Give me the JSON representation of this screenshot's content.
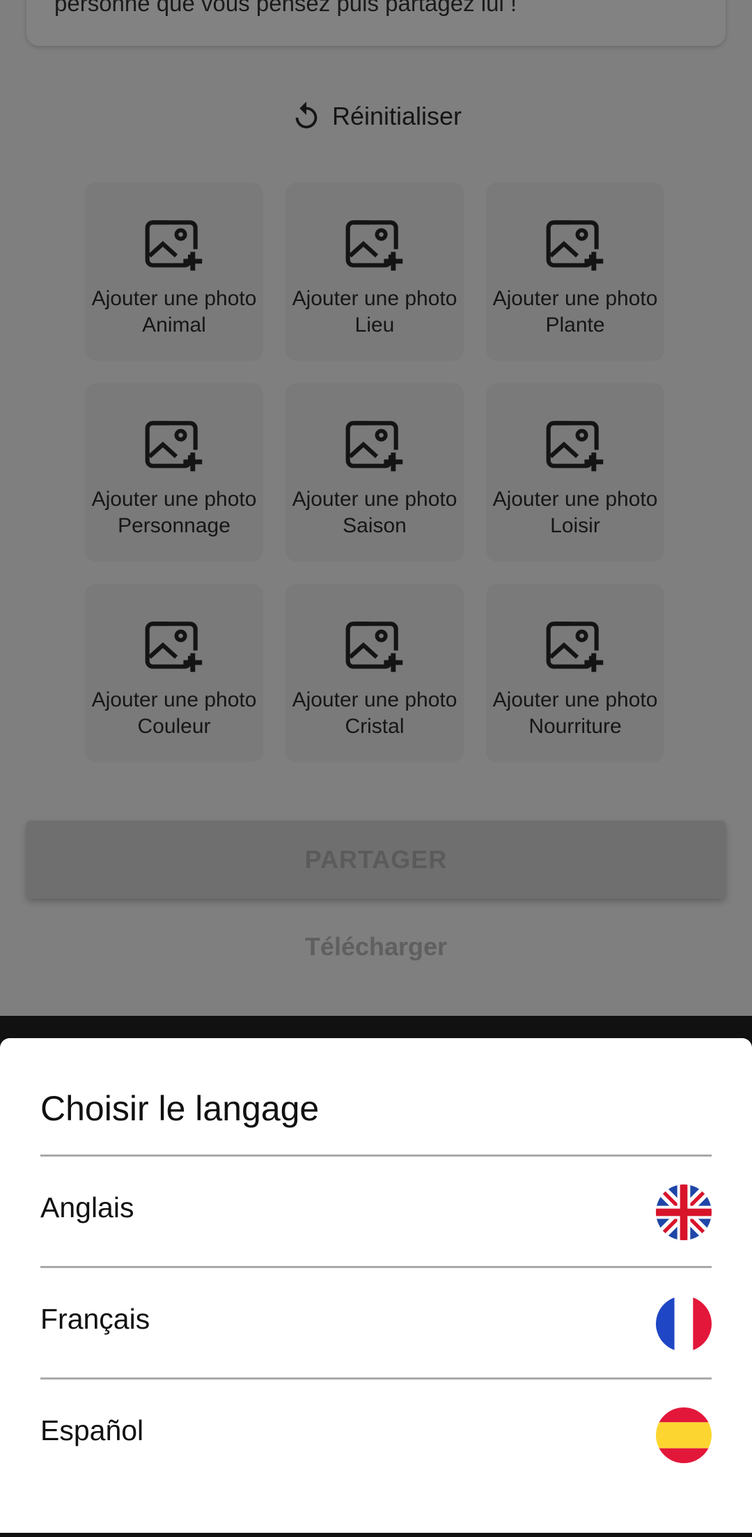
{
  "background": {
    "info_text": "personne que vous pensez puis partagez lui !",
    "reset_label": "Réinitialiser",
    "tiles": [
      {
        "line1": "Ajouter une photo",
        "line2": "Animal"
      },
      {
        "line1": "Ajouter une photo",
        "line2": "Lieu"
      },
      {
        "line1": "Ajouter une photo",
        "line2": "Plante"
      },
      {
        "line1": "Ajouter une photo",
        "line2": "Personnage"
      },
      {
        "line1": "Ajouter une photo",
        "line2": "Saison"
      },
      {
        "line1": "Ajouter une photo",
        "line2": "Loisir"
      },
      {
        "line1": "Ajouter une photo",
        "line2": "Couleur"
      },
      {
        "line1": "Ajouter une photo",
        "line2": "Cristal"
      },
      {
        "line1": "Ajouter une photo",
        "line2": "Nourriture"
      }
    ],
    "share_label": "PARTAGER",
    "download_label": "Télécharger"
  },
  "language_sheet": {
    "title": "Choisir le langage",
    "options": [
      {
        "label": "Anglais",
        "flag_icon": "uk-flag-icon"
      },
      {
        "label": "Français",
        "flag_icon": "france-flag-icon"
      },
      {
        "label": "Español",
        "flag_icon": "spain-flag-icon"
      }
    ]
  },
  "colors": {
    "scrim_background": "#7f7f7f",
    "sheet_background": "#ffffff",
    "divider": "#a9a9a9"
  }
}
